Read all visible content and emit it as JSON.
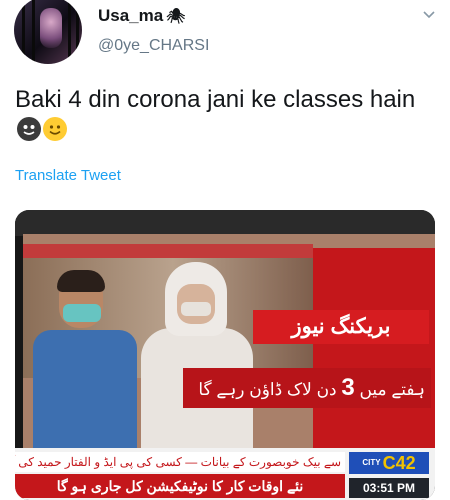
{
  "user": {
    "display_name": "Usa_ma",
    "name_icon": "spider-icon",
    "handle": "@0ye_CHARSI"
  },
  "tweet": {
    "text": "Baki 4 din corona jani ke classes hain",
    "emojis": [
      "dark-face-emoji",
      "smiling-face-emoji"
    ],
    "translate_label": "Translate Tweet"
  },
  "media": {
    "breaking_label": "بریکنگ نیوز",
    "headline_before": "ہفتے میں ",
    "headline_number": "3",
    "headline_after": " دن لاک ڈاؤن رہے گا",
    "ticker_line1": "سے بیک خوبصورت کے بیانات  —  کسی کی پی ایڈ و الفتار حمید کی آج سا",
    "ticker_line2": "نئے اوقات کار کا نوٹیفکیشن کل جاری ہو گا",
    "channel_logo": "C42",
    "channel_small": "CITY",
    "time": "03:51 PM"
  },
  "colors": {
    "link_blue": "#1da1f2",
    "text_primary": "#14171a",
    "text_secondary": "#657786",
    "news_red": "#c4171b",
    "channel_blue": "#1f4fb8"
  }
}
